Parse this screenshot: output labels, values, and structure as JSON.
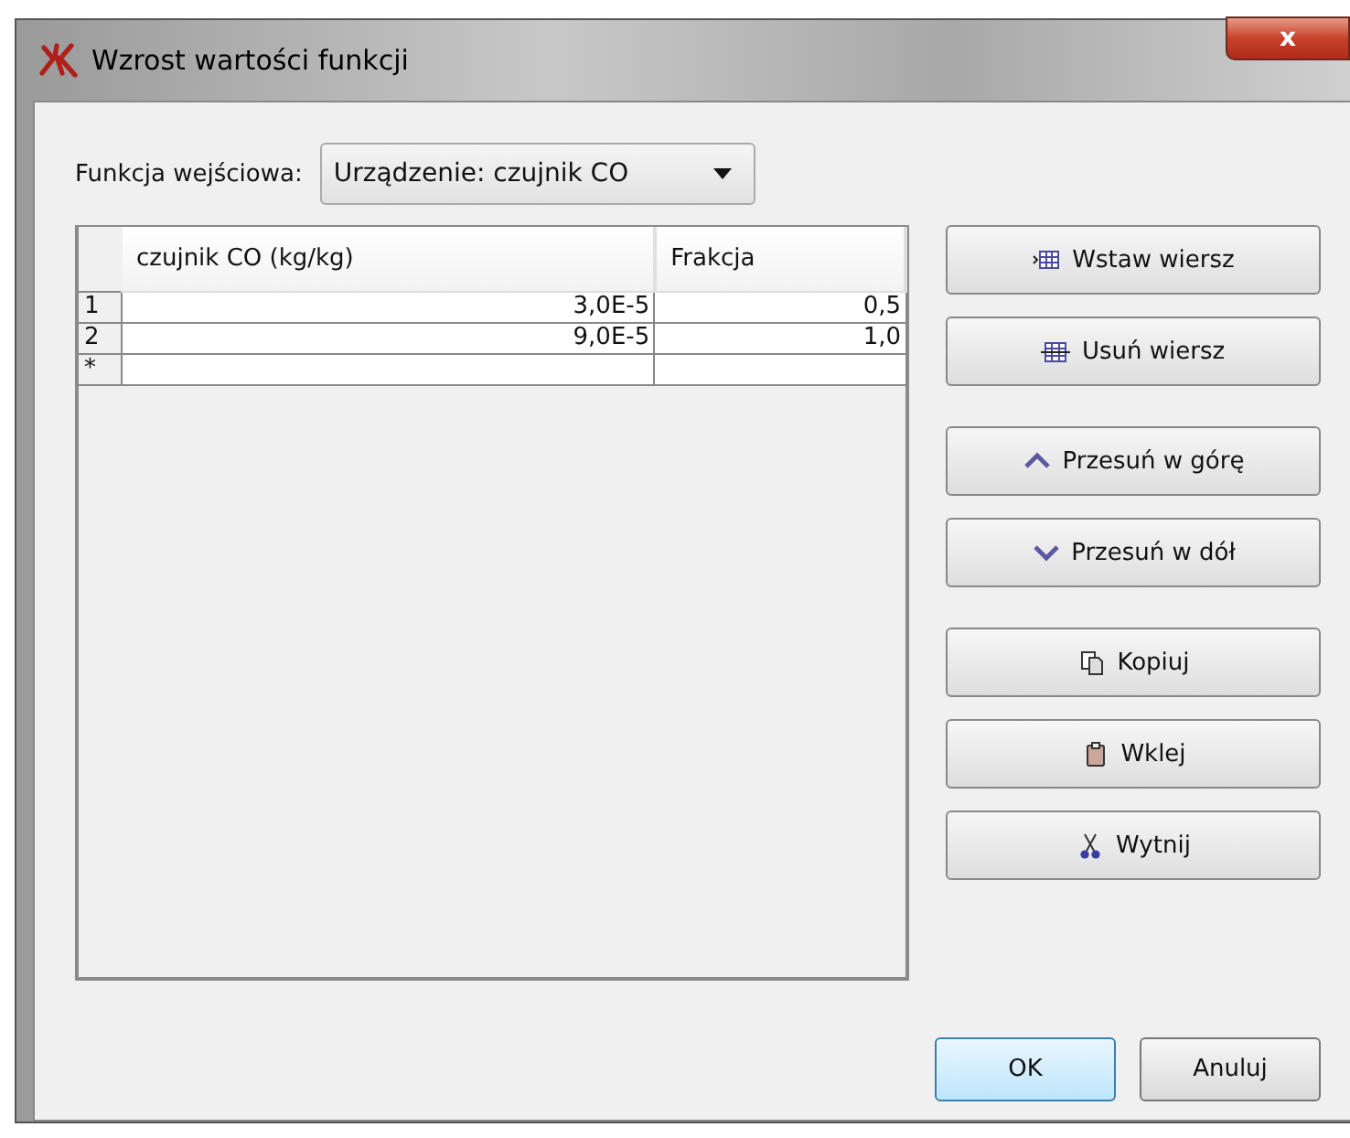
{
  "window": {
    "title": "Wzrost wartości funkcji",
    "close": "x"
  },
  "input_function": {
    "label": "Funkcja wejściowa:",
    "value": "Urządzenie: czujnik CO"
  },
  "table": {
    "columns": [
      "czujnik CO (kg/kg)",
      "Frakcja"
    ],
    "rows": [
      {
        "header": "1",
        "cells": [
          "3,0E-5",
          "0,5"
        ]
      },
      {
        "header": "2",
        "cells": [
          "9,0E-5",
          "1,0"
        ]
      },
      {
        "header": "*",
        "cells": [
          "",
          ""
        ]
      }
    ]
  },
  "side_button_groups": [
    [
      {
        "label": "Wstaw wiersz",
        "kind": "insert"
      },
      {
        "label": "Usuń wiersz",
        "kind": "delete"
      }
    ],
    [
      {
        "label": "Przesuń w górę",
        "kind": "up"
      },
      {
        "label": "Przesuń w dół",
        "kind": "down"
      }
    ],
    [
      {
        "label": "Kopiuj",
        "kind": "copy"
      },
      {
        "label": "Wklej",
        "kind": "paste"
      },
      {
        "label": "Wytnij",
        "kind": "cut"
      }
    ]
  ],
  "dialog_buttons": [
    {
      "label": "OK",
      "default": true
    },
    {
      "label": "Anuluj",
      "default": false
    }
  ]
}
